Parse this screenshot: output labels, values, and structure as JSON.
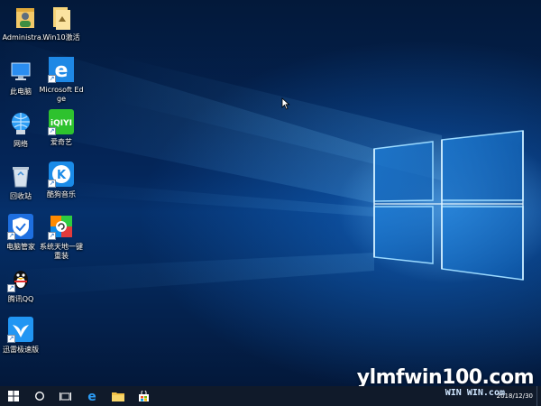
{
  "desktop_icons": [
    {
      "id": "administrator",
      "label": "Administra...",
      "icon": "user-folder-icon"
    },
    {
      "id": "win10",
      "label": "Win10激活",
      "icon": "folder-icon"
    },
    {
      "id": "this-pc",
      "label": "此电脑",
      "icon": "computer-icon"
    },
    {
      "id": "edge",
      "label": "Microsoft Edge",
      "icon": "edge-icon"
    },
    {
      "id": "network",
      "label": "网络",
      "icon": "network-icon"
    },
    {
      "id": "iqiyi",
      "label": "爱奇艺",
      "icon": "iqiyi-icon"
    },
    {
      "id": "recycle-bin",
      "label": "回收站",
      "icon": "recycle-bin-icon"
    },
    {
      "id": "kugou",
      "label": "酷狗音乐",
      "icon": "kugou-icon"
    },
    {
      "id": "pc-manager",
      "label": "电脑管家",
      "icon": "shield-icon"
    },
    {
      "id": "reinstall",
      "label": "系统天地一键重装",
      "icon": "reinstall-icon"
    },
    {
      "id": "qq",
      "label": "腾讯QQ",
      "icon": "qq-penguin-icon"
    },
    {
      "id": "xunlei",
      "label": "迅雷极速版",
      "icon": "xunlei-bird-icon"
    }
  ],
  "iqiyi_logo_text": "iQIYI",
  "kugou_logo_text": "K",
  "taskbar": {
    "start": "windows-start-icon",
    "cortana": "cortana-circle-icon",
    "task_view": "task-view-icon",
    "pinned": [
      "edge-icon",
      "file-explorer-icon",
      "store-icon"
    ]
  },
  "clock": {
    "date": "2018/12/30"
  },
  "watermark": {
    "main": "ylmfwin100.com",
    "sub": "WIN WIN.com"
  },
  "colors": {
    "taskbar": "#101a2a",
    "accent": "#1e88e5"
  }
}
